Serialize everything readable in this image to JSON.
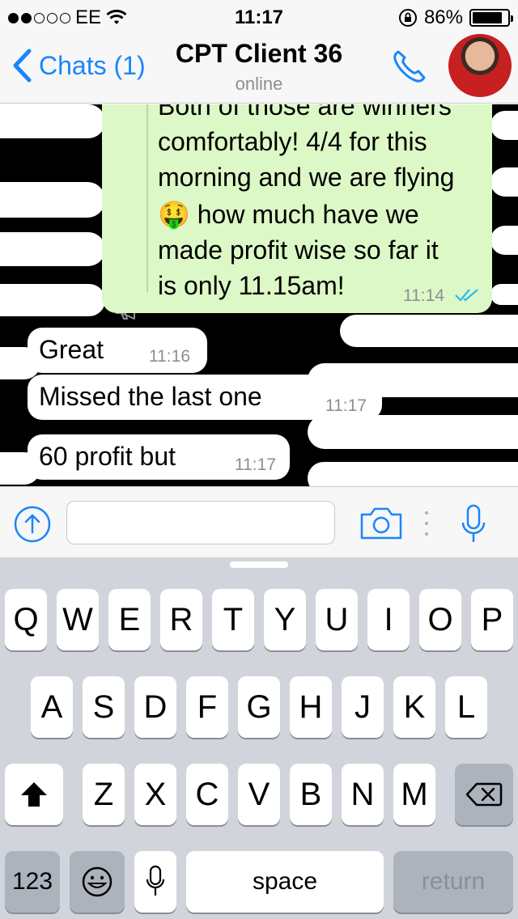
{
  "status_bar": {
    "carrier": "EE",
    "time": "11:17",
    "battery": "86%",
    "signal_bars": 2,
    "battery_level": 0.86,
    "icons": [
      "signal-dots-icon",
      "wifi-icon",
      "orientation-lock-icon",
      "battery-icon"
    ]
  },
  "header": {
    "back_label": "Chats (1)",
    "title": "CPT Client 36",
    "subtitle": "online",
    "icons": [
      "chevron-left-icon",
      "phone-icon"
    ]
  },
  "messages": [
    {
      "direction": "outgoing",
      "lines": [
        "Both of those are winners",
        "comfortably! 4/4 for this",
        "morning and we are flying",
        "🤑 how much have we",
        "made profit wise so far it",
        "is only 11.15am!"
      ],
      "time": "11:14",
      "status": "read",
      "icons": [
        "megaphone-icon",
        "double-check-icon"
      ]
    },
    {
      "direction": "incoming",
      "text": "Great",
      "time": "11:16"
    },
    {
      "direction": "incoming",
      "text": "Missed the last one",
      "time": "11:17"
    },
    {
      "direction": "incoming",
      "text": "60 profit but",
      "time": "11:17"
    }
  ],
  "input_bar": {
    "value": "",
    "placeholder": "",
    "icons": [
      "upload-icon",
      "camera-icon",
      "microphone-icon"
    ]
  },
  "keyboard": {
    "row1": [
      "Q",
      "W",
      "E",
      "R",
      "T",
      "Y",
      "U",
      "I",
      "O",
      "P"
    ],
    "row2": [
      "A",
      "S",
      "D",
      "F",
      "G",
      "H",
      "J",
      "K",
      "L"
    ],
    "row3": [
      "Z",
      "X",
      "C",
      "V",
      "B",
      "N",
      "M"
    ],
    "numbers_label": "123",
    "space_label": "space",
    "return_label": "return",
    "icons": [
      "shift-icon",
      "delete-icon",
      "emoji-icon",
      "dictation-mic-icon"
    ]
  },
  "colors": {
    "accent": "#1a86fb",
    "outgoing_bubble": "#dcf8c6",
    "incoming_bubble": "#ffffff",
    "read_tick": "#34b7f1",
    "keyboard_bg": "#d1d5db"
  }
}
